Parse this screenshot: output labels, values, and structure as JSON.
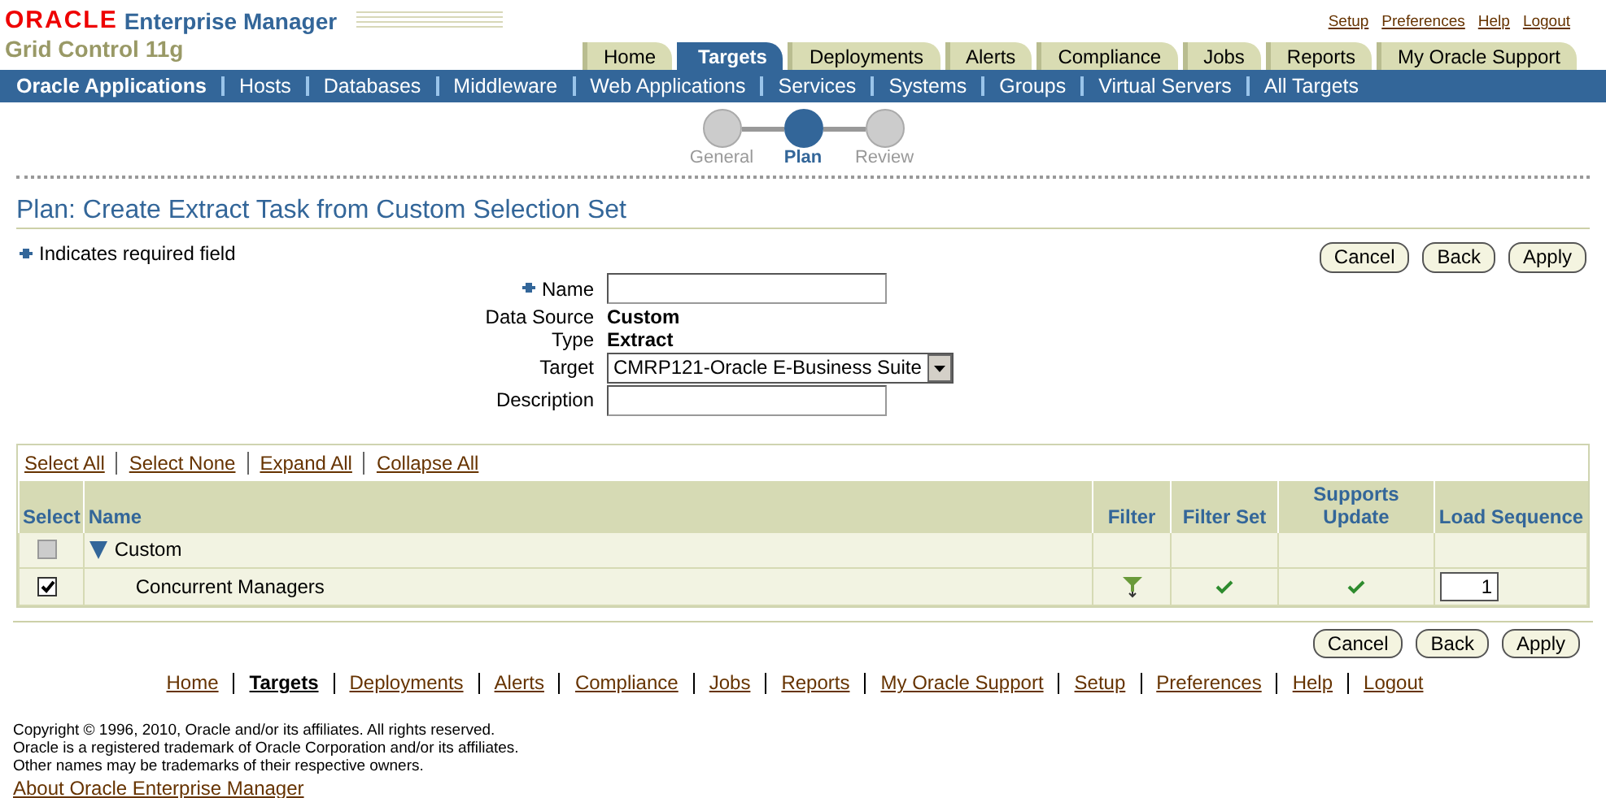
{
  "header": {
    "brand": "ORACLE",
    "product": "Enterprise Manager",
    "subtitle": "Grid Control 11g",
    "global_links": [
      "Setup",
      "Preferences",
      "Help",
      "Logout"
    ]
  },
  "tabs": [
    {
      "label": "Home",
      "selected": false
    },
    {
      "label": "Targets",
      "selected": true
    },
    {
      "label": "Deployments",
      "selected": false
    },
    {
      "label": "Alerts",
      "selected": false
    },
    {
      "label": "Compliance",
      "selected": false
    },
    {
      "label": "Jobs",
      "selected": false
    },
    {
      "label": "Reports",
      "selected": false
    },
    {
      "label": "My Oracle Support",
      "selected": false
    }
  ],
  "subtabs": [
    {
      "label": "Oracle Applications",
      "selected": true
    },
    {
      "label": "Hosts",
      "selected": false
    },
    {
      "label": "Databases",
      "selected": false
    },
    {
      "label": "Middleware",
      "selected": false
    },
    {
      "label": "Web Applications",
      "selected": false
    },
    {
      "label": "Services",
      "selected": false
    },
    {
      "label": "Systems",
      "selected": false
    },
    {
      "label": "Groups",
      "selected": false
    },
    {
      "label": "Virtual Servers",
      "selected": false
    },
    {
      "label": "All Targets",
      "selected": false
    }
  ],
  "train": [
    {
      "label": "General",
      "selected": false
    },
    {
      "label": "Plan",
      "selected": true
    },
    {
      "label": "Review",
      "selected": false
    }
  ],
  "page_title": "Plan: Create Extract Task from Custom Selection Set",
  "required_note": "Indicates required field",
  "buttons_top": [
    "Cancel",
    "Back",
    "Apply"
  ],
  "form": [
    {
      "kind": "input",
      "label": "Name",
      "required": true
    },
    {
      "kind": "text",
      "label": "Data Source",
      "value": "Custom"
    },
    {
      "kind": "text",
      "label": "Type",
      "value": "Extract"
    },
    {
      "kind": "select",
      "label": "Target",
      "value": "CMRP121-Oracle E-Business Suite"
    },
    {
      "kind": "input",
      "label": "Description",
      "required": false
    }
  ],
  "table": {
    "actions": [
      "Select All",
      "Select None",
      "Expand All",
      "Collapse All"
    ],
    "columns": [
      "Select",
      "Name",
      "Filter",
      "Filter Set",
      "Supports Update",
      "Load Sequence"
    ],
    "rows": [
      {
        "name": "Custom",
        "checked": false,
        "disabled": true,
        "expanded": true,
        "children": [
          {
            "name": "Concurrent Managers",
            "checked": true,
            "disabled": false,
            "filter": true,
            "filter_set": true,
            "supports_update": true,
            "load_sequence": "1"
          }
        ]
      }
    ]
  },
  "buttons_bottom": [
    "Cancel",
    "Back",
    "Apply"
  ],
  "footer_links": [
    {
      "label": "Home",
      "selected": false
    },
    {
      "label": "Targets",
      "selected": true
    },
    {
      "label": "Deployments",
      "selected": false
    },
    {
      "label": "Alerts",
      "selected": false
    },
    {
      "label": "Compliance",
      "selected": false
    },
    {
      "label": "Jobs",
      "selected": false
    },
    {
      "label": "Reports",
      "selected": false
    },
    {
      "label": "My Oracle Support",
      "selected": false
    },
    {
      "label": "Setup",
      "selected": false
    },
    {
      "label": "Preferences",
      "selected": false
    },
    {
      "label": "Help",
      "selected": false
    },
    {
      "label": "Logout",
      "selected": false
    }
  ],
  "copyright": [
    "Copyright © 1996, 2010, Oracle and/or its affiliates. All rights reserved.",
    "Oracle is a registered trademark of Oracle Corporation and/or its affiliates.",
    "Other names may be trademarks of their respective owners."
  ],
  "about_link": "About Oracle Enterprise Manager"
}
